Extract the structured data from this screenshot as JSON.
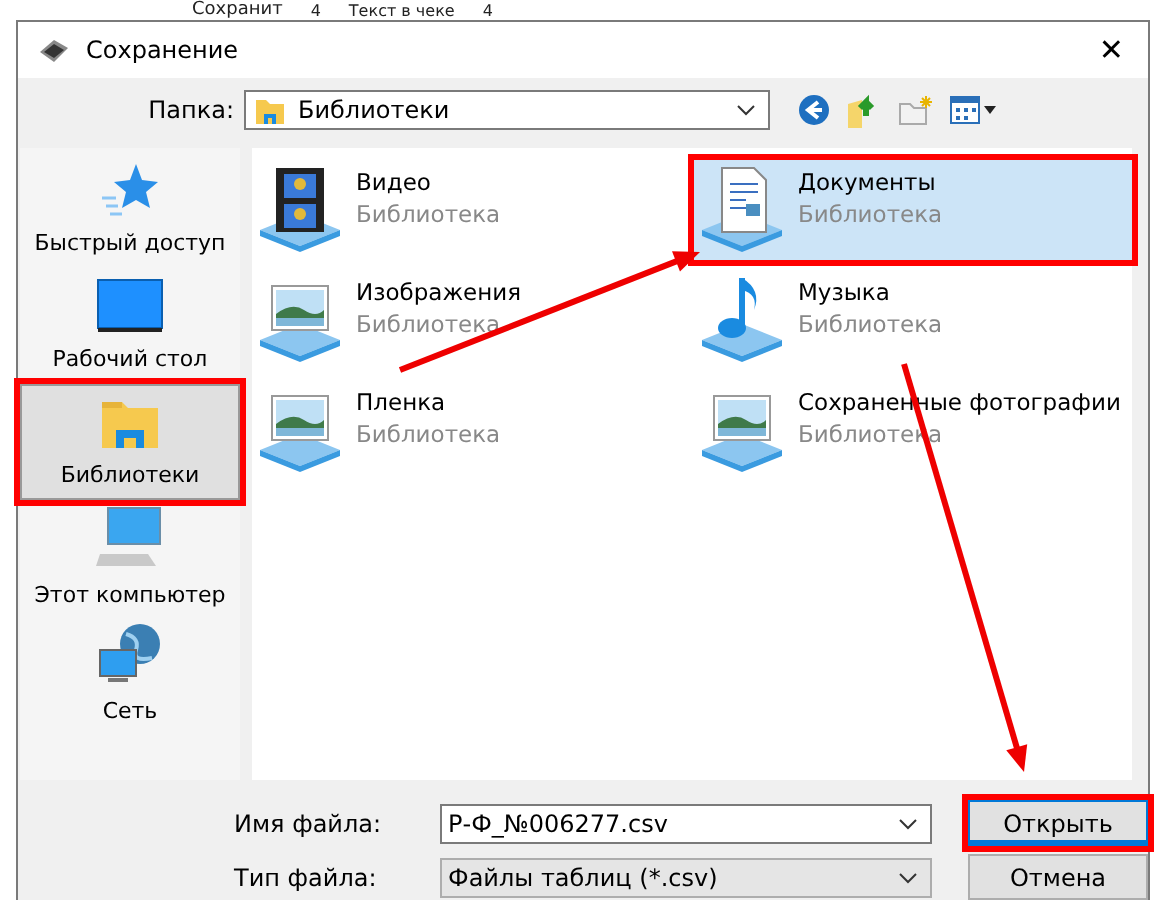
{
  "background": {
    "texts": [
      "Сохранит",
      "4",
      "Текст в чеке",
      "4"
    ]
  },
  "window": {
    "title": "Сохранение",
    "close": "✕"
  },
  "toolbar": {
    "folder_label": "Папка:",
    "folder": "Библиотеки"
  },
  "sidebar": {
    "items": [
      {
        "label": "Быстрый доступ",
        "kind": "star",
        "selected": false,
        "highlighted": false
      },
      {
        "label": "Рабочий стол",
        "kind": "desktop",
        "selected": false,
        "highlighted": false
      },
      {
        "label": "Библиотеки",
        "kind": "libraries",
        "selected": true,
        "highlighted": true
      },
      {
        "label": "Этот компьютер",
        "kind": "computer",
        "selected": false,
        "highlighted": false
      },
      {
        "label": "Сеть",
        "kind": "network",
        "selected": false,
        "highlighted": false
      }
    ]
  },
  "libraries": [
    {
      "name": "Видео",
      "type": "Библиотека",
      "kind": "video",
      "selected": false,
      "highlighted": false
    },
    {
      "name": "Документы",
      "type": "Библиотека",
      "kind": "documents",
      "selected": true,
      "highlighted": true
    },
    {
      "name": "Изображения",
      "type": "Библиотека",
      "kind": "pictures",
      "selected": false,
      "highlighted": false
    },
    {
      "name": "Музыка",
      "type": "Библиотека",
      "kind": "music",
      "selected": false,
      "highlighted": false
    },
    {
      "name": "Пленка",
      "type": "Библиотека",
      "kind": "pictures",
      "selected": false,
      "highlighted": false
    },
    {
      "name": "Сохраненные фотографии",
      "type": "Библиотека",
      "kind": "pictures",
      "selected": false,
      "highlighted": false
    }
  ],
  "file_name": {
    "label": "Имя файла:",
    "value": "Р-Ф_№006277.csv"
  },
  "file_type": {
    "label": "Тип файла:",
    "value": "Файлы таблиц (*.csv)"
  },
  "buttons": [
    {
      "label": "Открыть",
      "highlighted": true
    },
    {
      "label": "Отмена",
      "highlighted": false
    }
  ],
  "annotation_arrows": [
    {
      "kind": "red-arrow"
    },
    {
      "kind": "red-arrow"
    }
  ]
}
